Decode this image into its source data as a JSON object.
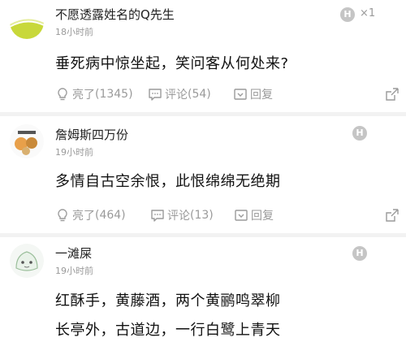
{
  "comments": [
    {
      "username": "不愿透露姓名的Q先生",
      "time": "18小时前",
      "content": [
        "垂死病中惊坐起，笑问客从何处来?"
      ],
      "badge": "H",
      "badge_count": "×1",
      "like_label": "亮了",
      "like_count": "(1345)",
      "comment_label": "评论",
      "comment_count": "(54)",
      "reply_label": "回复"
    },
    {
      "username": "詹姆斯四万份",
      "time": "19小时前",
      "content": [
        "多情自古空余恨，此恨绵绵无绝期"
      ],
      "badge": "H",
      "like_label": "亮了",
      "like_count": "(464)",
      "comment_label": "评论",
      "comment_count": "(13)",
      "reply_label": "回复"
    },
    {
      "username": "一滩屎",
      "time": "19小时前",
      "content": [
        "红酥手，黄藤酒，两个黄鹂鸣翠柳",
        "长亭外，古道边，一行白鹭上青天"
      ],
      "badge": "H"
    }
  ],
  "colors": {
    "avatar1": "#c8d83a",
    "muted": "#9a9a9a",
    "badge": "#c5c5c5"
  }
}
